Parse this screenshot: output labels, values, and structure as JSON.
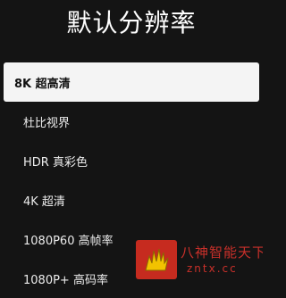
{
  "header": {
    "title": "默认分辨率"
  },
  "resolution_options": [
    {
      "label": "8K 超高清",
      "selected": true
    },
    {
      "label": "杜比视界",
      "selected": false
    },
    {
      "label": "HDR 真彩色",
      "selected": false
    },
    {
      "label": "4K 超清",
      "selected": false
    },
    {
      "label": "1080P60 高帧率",
      "selected": false
    },
    {
      "label": "1080P+ 高码率",
      "selected": false
    }
  ],
  "watermark": {
    "name": "八神智能天下",
    "domain": "zntx.cc",
    "logo_icon": "hand-icon",
    "color": "#c62b1f"
  },
  "colors": {
    "background": "#141414",
    "selected_background": "#f4f4f4",
    "selected_text": "#111111",
    "text": "#ececec"
  }
}
